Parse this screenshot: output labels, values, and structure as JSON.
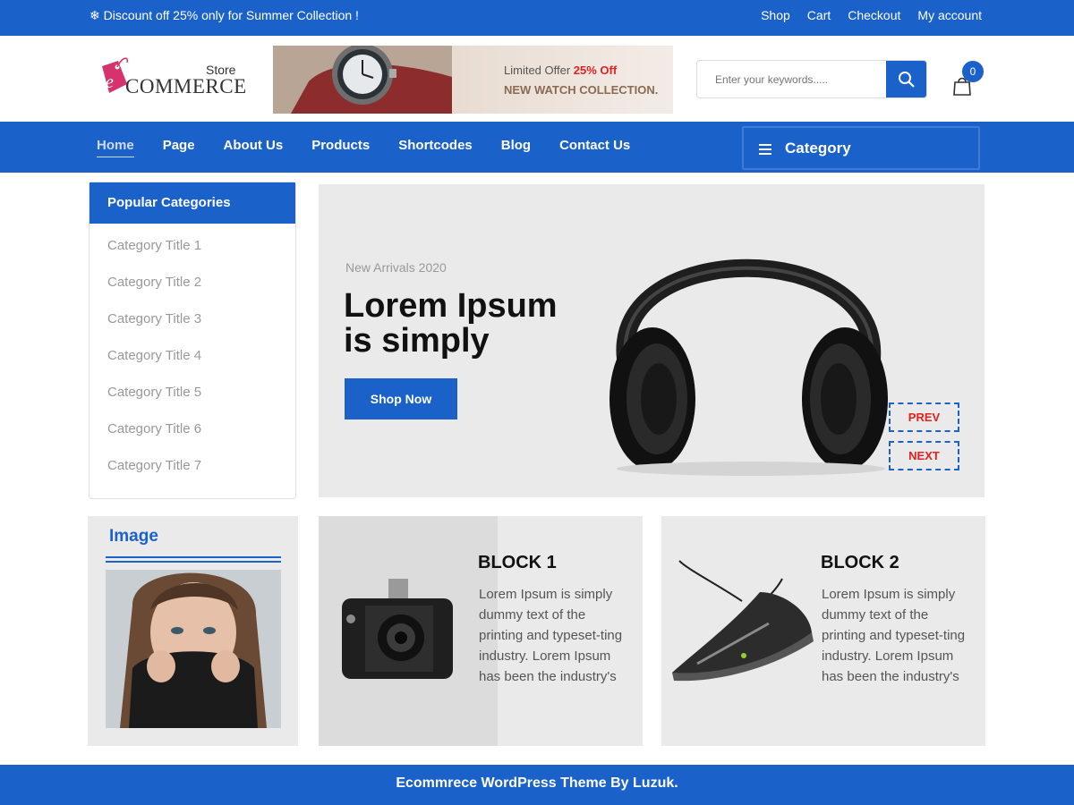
{
  "topbar": {
    "promo": "❄ Discount off 25% only for Summer Collection !",
    "links": [
      "Shop",
      "Cart",
      "Checkout",
      "My account"
    ]
  },
  "logo": {
    "store": "Store",
    "commerce": "COMMERCE",
    "e_letter": "e"
  },
  "banner": {
    "limited": "Limited Offer ",
    "off": "25% Off",
    "collection": "NEW WATCH COLLECTION."
  },
  "search": {
    "placeholder": "Enter your keywords....."
  },
  "cart": {
    "count": "0"
  },
  "nav": {
    "items": [
      "Home",
      "Page",
      "About Us",
      "Products",
      "Shortcodes",
      "Blog",
      "Contact Us"
    ],
    "category": "Category"
  },
  "sidebar": {
    "title": "Popular Categories",
    "items": [
      "Category Title 1",
      "Category Title 2",
      "Category Title 3",
      "Category Title 4",
      "Category Title 5",
      "Category Title 6",
      "Category Title 7"
    ]
  },
  "hero": {
    "subtitle": "New Arrivals 2020",
    "title_line1": "Lorem Ipsum",
    "title_line2": "is simply",
    "button": "Shop Now",
    "prev": "PREV",
    "next": "NEXT"
  },
  "image_widget": {
    "title": "Image"
  },
  "block1": {
    "title": "BLOCK 1",
    "text": "Lorem Ipsum is simply dummy text of the printing and typeset-ting industry. Lorem Ipsum has been the industry's"
  },
  "block2": {
    "title": "BLOCK 2",
    "text": "Lorem Ipsum is simply dummy text of the printing and typeset-ting industry. Lorem Ipsum has been the industry's"
  },
  "footer": {
    "text": "Ecommrece WordPress Theme By Luzuk."
  },
  "colors": {
    "primary": "#1a61c9",
    "accent_red": "#e52020",
    "logo_pink": "#d6336c"
  }
}
